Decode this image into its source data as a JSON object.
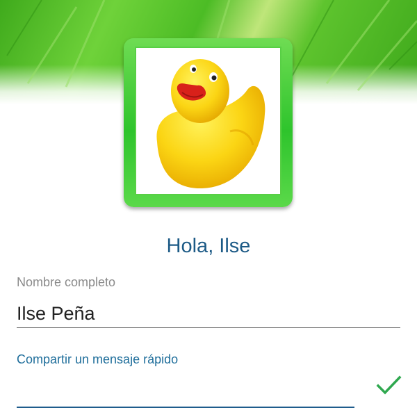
{
  "header": {
    "background_icon": "grass-banner",
    "accent_color": "#4cbc25"
  },
  "profile": {
    "avatar_icon": "rubber-duck-icon",
    "frame_color": "#2ec42c",
    "greeting": "Hola, Ilse"
  },
  "form": {
    "name_label": "Nombre completo",
    "name_value": "Ilse Peña",
    "message_label": "Compartir un mensaje rápido",
    "message_value": "",
    "confirm_icon": "checkmark-icon",
    "accent_color": "#1f5c8c",
    "confirm_color": "#2fa84f"
  }
}
